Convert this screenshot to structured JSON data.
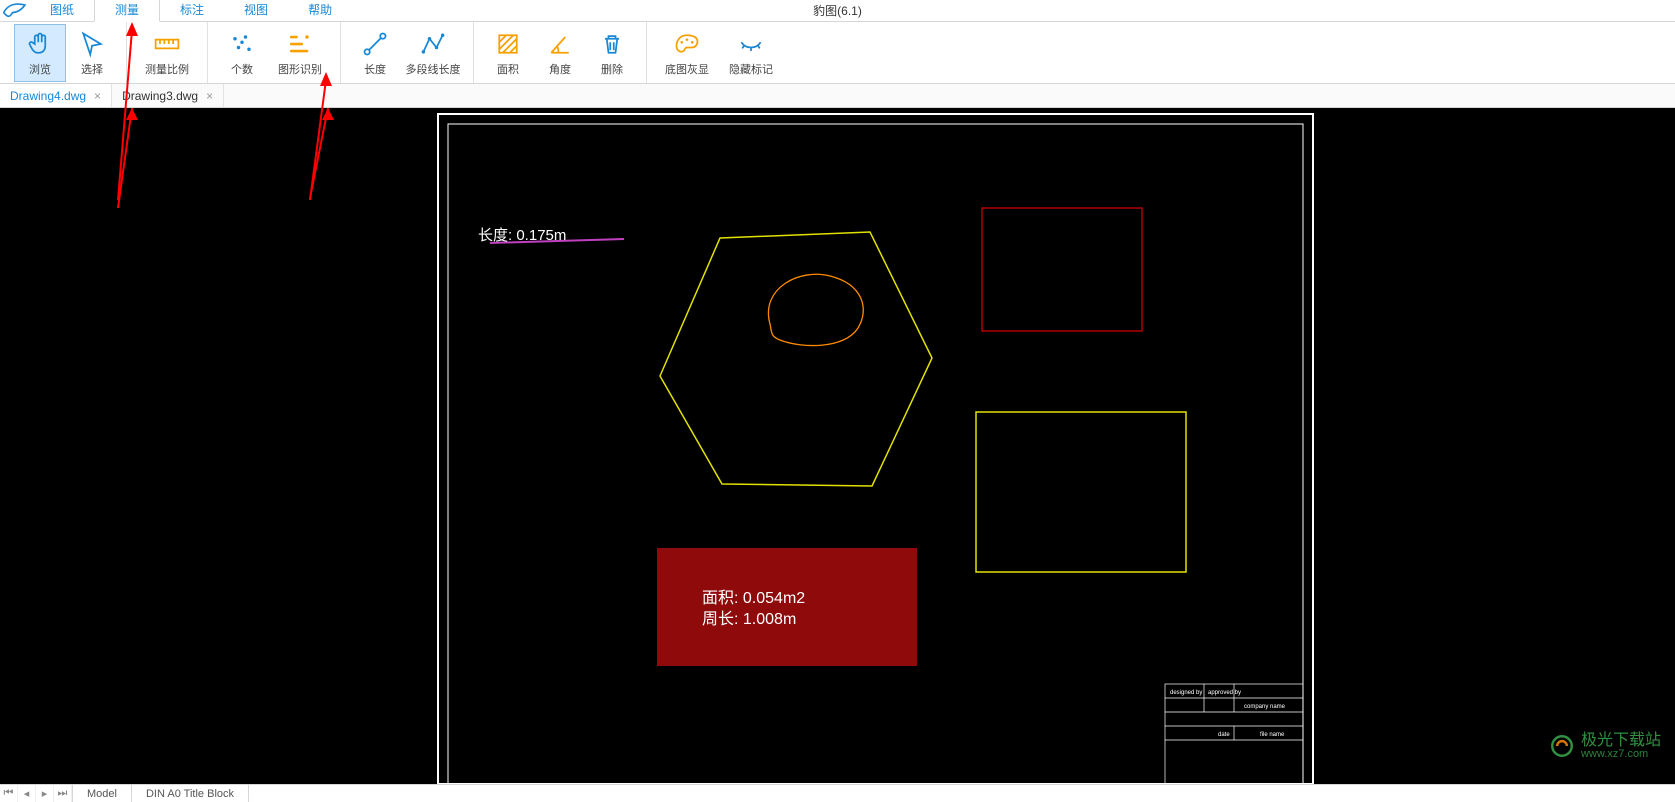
{
  "app": {
    "title": "豹图(6.1)"
  },
  "menubar": {
    "items": [
      {
        "label": "图纸"
      },
      {
        "label": "测量",
        "active": true
      },
      {
        "label": "标注"
      },
      {
        "label": "视图"
      },
      {
        "label": "帮助"
      }
    ]
  },
  "ribbon": {
    "groups": [
      {
        "tools": [
          {
            "name": "browse",
            "label": "浏览",
            "active": true
          },
          {
            "name": "select",
            "label": "选择"
          }
        ]
      },
      {
        "tools": [
          {
            "name": "scale",
            "label": "测量比例"
          }
        ]
      },
      {
        "tools": [
          {
            "name": "count",
            "label": "个数"
          },
          {
            "name": "shape-detect",
            "label": "图形识别"
          }
        ]
      },
      {
        "tools": [
          {
            "name": "length",
            "label": "长度"
          },
          {
            "name": "polyline-length",
            "label": "多段线长度"
          }
        ]
      },
      {
        "tools": [
          {
            "name": "area",
            "label": "面积"
          },
          {
            "name": "angle",
            "label": "角度"
          },
          {
            "name": "delete",
            "label": "删除"
          }
        ]
      },
      {
        "tools": [
          {
            "name": "gray-base",
            "label": "底图灰显"
          },
          {
            "name": "hide-marks",
            "label": "隐藏标记"
          }
        ]
      }
    ]
  },
  "tabs": {
    "files": [
      {
        "name": "Drawing4.dwg",
        "active": true
      },
      {
        "name": "Drawing3.dwg",
        "active": false
      }
    ]
  },
  "canvas": {
    "length_annotation": {
      "prefix": "长度:",
      "value": "0.175m"
    },
    "area_box": {
      "line1_prefix": "面积:",
      "line1_value": "0.054m2",
      "line2_prefix": "周长:",
      "line2_value": "1.008m"
    },
    "title_block": {
      "designed_by": "designed by",
      "company_name": "company name",
      "date": "date",
      "file_name": "file name",
      "approved_by": "approved by"
    }
  },
  "bottom": {
    "tabs": [
      {
        "label": "Model"
      },
      {
        "label": "DIN A0 Title Block"
      }
    ]
  },
  "watermark": {
    "top": "极光下载站",
    "bottom": "www.xz7.com"
  }
}
